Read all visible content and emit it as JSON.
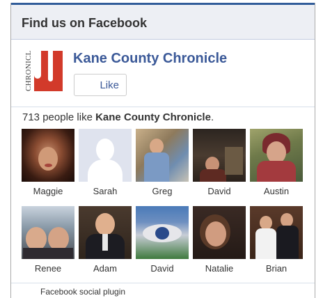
{
  "widget": {
    "title": "Find us on Facebook",
    "page_name": "Kane County Chronicle",
    "like_label": "Like",
    "logo_text": "CHRONICLE",
    "count_text": "713 people like ",
    "count_page": "Kane County Chronicle",
    "count_suffix": ".",
    "footer": "Facebook social plugin"
  },
  "fans_row1": [
    {
      "name": "Maggie",
      "icon": "profile-photo"
    },
    {
      "name": "Sarah",
      "icon": "default-silhouette"
    },
    {
      "name": "Greg",
      "icon": "profile-photo"
    },
    {
      "name": "David",
      "icon": "profile-photo"
    },
    {
      "name": "Austin",
      "icon": "profile-photo"
    }
  ],
  "fans_row2": [
    {
      "name": "Renee",
      "icon": "profile-photo"
    },
    {
      "name": "Adam",
      "icon": "profile-photo"
    },
    {
      "name": "David",
      "icon": "profile-photo"
    },
    {
      "name": "Natalie",
      "icon": "profile-photo"
    },
    {
      "name": "Brian",
      "icon": "profile-photo"
    }
  ],
  "colors": {
    "brand_blue": "#3b5998",
    "header_bg": "#edeff4",
    "logo_red": "#d23a2a"
  }
}
